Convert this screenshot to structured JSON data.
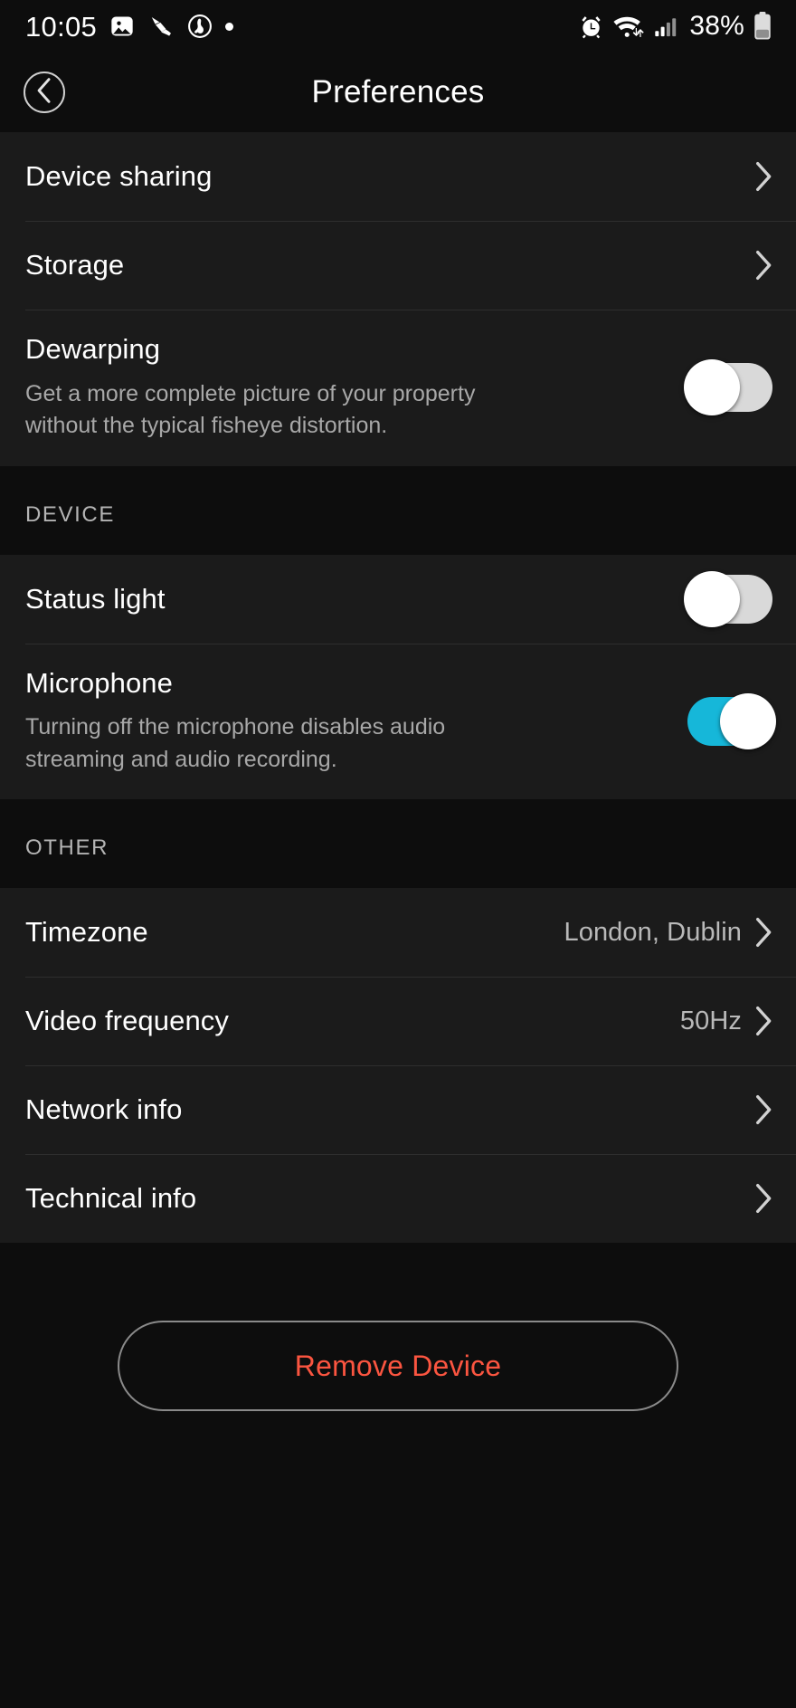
{
  "statusbar": {
    "time": "10:05",
    "battery_percent": "38%",
    "left_icons": [
      "gallery-icon",
      "brush-icon",
      "pet-circle-icon",
      "dot-icon"
    ],
    "right_icons": [
      "alarm-icon",
      "wifi-icon",
      "signal-icon",
      "battery-icon"
    ]
  },
  "header": {
    "title": "Preferences",
    "back_icon": "chevron-left-icon"
  },
  "colors": {
    "toggle_on": "#16b7d9",
    "toggle_off": "#d9d9d9",
    "danger": "#fb5540",
    "row_bg": "#1b1b1b",
    "page_bg": "#0d0d0d"
  },
  "sections": [
    {
      "header": "",
      "rows": [
        {
          "title": "Device sharing",
          "desc": "",
          "value": "",
          "control": "chevron",
          "toggle_state": ""
        },
        {
          "title": "Storage",
          "desc": "",
          "value": "",
          "control": "chevron",
          "toggle_state": ""
        },
        {
          "title": "Dewarping",
          "desc": "Get a more complete picture of your property without the typical fisheye distortion.",
          "value": "",
          "control": "toggle",
          "toggle_state": "off"
        }
      ]
    },
    {
      "header": "DEVICE",
      "rows": [
        {
          "title": "Status light",
          "desc": "",
          "value": "",
          "control": "toggle",
          "toggle_state": "off"
        },
        {
          "title": "Microphone",
          "desc": "Turning off the microphone disables audio streaming and audio recording.",
          "value": "",
          "control": "toggle",
          "toggle_state": "on"
        }
      ]
    },
    {
      "header": "OTHER",
      "rows": [
        {
          "title": "Timezone",
          "desc": "",
          "value": "London, Dublin",
          "control": "chevron",
          "toggle_state": ""
        },
        {
          "title": "Video frequency",
          "desc": "",
          "value": "50Hz",
          "control": "chevron",
          "toggle_state": ""
        },
        {
          "title": "Network info",
          "desc": "",
          "value": "",
          "control": "chevron",
          "toggle_state": ""
        },
        {
          "title": "Technical info",
          "desc": "",
          "value": "",
          "control": "chevron",
          "toggle_state": ""
        }
      ]
    }
  ],
  "footer": {
    "remove_label": "Remove Device"
  }
}
